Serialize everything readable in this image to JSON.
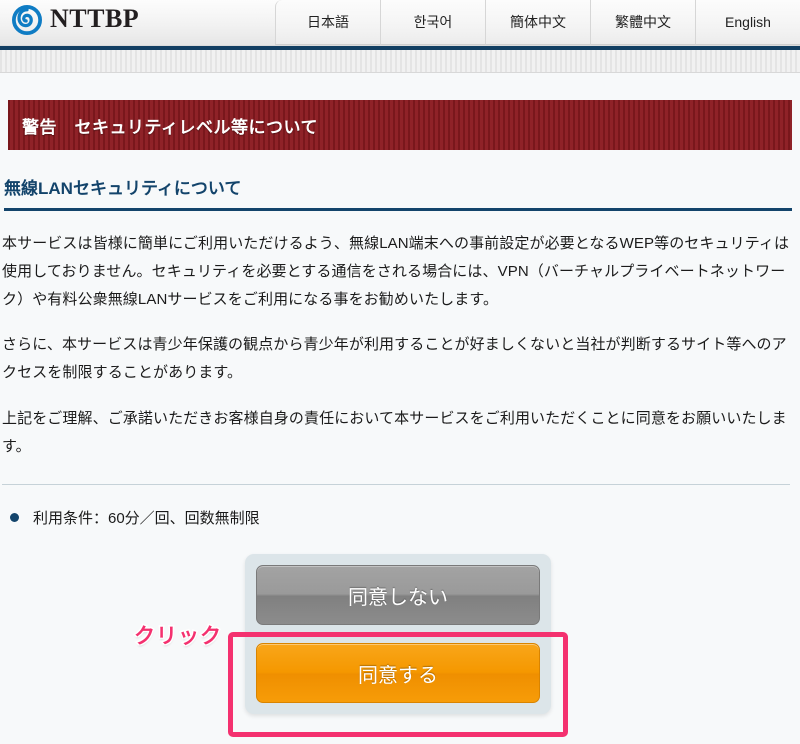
{
  "header": {
    "logo_icon": "nttbp-swirl-logo-icon",
    "logo_text": "NTTBP",
    "language_tabs": [
      {
        "label": "日本語"
      },
      {
        "label": "한국어"
      },
      {
        "label": "簡体中文"
      },
      {
        "label": "繁體中文"
      },
      {
        "label": "English"
      }
    ]
  },
  "banner": {
    "text": "警告　セキュリティレベル等について"
  },
  "section": {
    "heading": "無線LANセキュリティについて",
    "paragraphs": [
      "本サービスは皆様に簡単にご利用いただけるよう、無線LAN端末への事前設定が必要となるWEP等のセキュリティは使用しておりません。セキュリティを必要とする通信をされる場合には、VPN（バーチャルプライベートネットワーク）や有料公衆無線LANサービスをご利用になる事をお勧めいたします。",
      "さらに、本サービスは青少年保護の観点から青少年が利用することが好ましくないと当社が判断するサイト等へのアクセスを制限することがあります。",
      "上記をご理解、ご承諾いただきお客様自身の責任において本サービスをご利用いただくことに同意をお願いいたします。"
    ]
  },
  "terms": {
    "bullet_text": "利用条件：60分／回、回数無制限"
  },
  "buttons": {
    "disagree_label": "同意しない",
    "agree_label": "同意する"
  },
  "annotation": {
    "click_label": "クリック"
  },
  "colors": {
    "banner_red": "#8b1a20",
    "heading_navy": "#13446b",
    "accent_orange": "#f59800",
    "highlight_pink": "#f4316f",
    "panel_bg": "#dce5e9",
    "page_bg": "#f7f9fa"
  }
}
